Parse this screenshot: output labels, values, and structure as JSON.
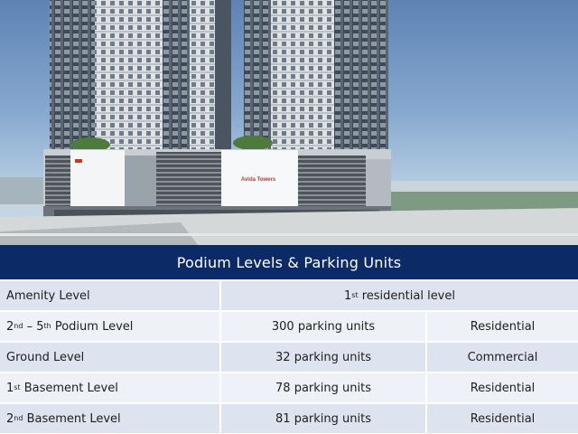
{
  "building_sign": "Avida Towers",
  "table": {
    "title": "Podium Levels & Parking Units",
    "rows": [
      {
        "level_num": "",
        "level_sup": "",
        "level_text": "Amenity Level",
        "merged": {
          "num": "1",
          "sup": "st",
          "text": " residential level"
        }
      },
      {
        "level_num": "2",
        "level_sup": "nd",
        "level_text": " – 5",
        "level_sup2": "th",
        "level_text2": " Podium Level",
        "parking": "300 parking units",
        "use": "Residential"
      },
      {
        "level_num": "",
        "level_sup": "",
        "level_text": "Ground Level",
        "parking": "32 parking units",
        "use": "Commercial"
      },
      {
        "level_num": "1",
        "level_sup": "st",
        "level_text": " Basement Level",
        "parking": "78 parking units",
        "use": "Residential"
      },
      {
        "level_num": "2",
        "level_sup": "nd",
        "level_text": " Basement Level",
        "parking": "81 parking units",
        "use": "Residential"
      }
    ]
  }
}
